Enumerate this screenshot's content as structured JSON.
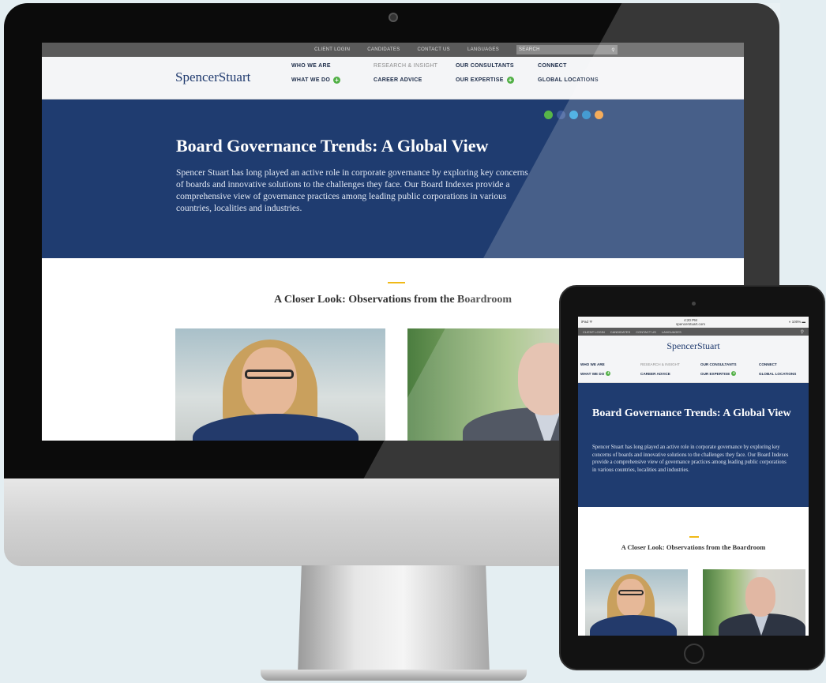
{
  "desktop": {
    "utility": {
      "client_login": "CLIENT LOGIN",
      "candidates": "CANDIDATES",
      "contact_us": "CONTACT US",
      "languages": "LANGUAGES",
      "search_placeholder": "SEARCH"
    },
    "logo": "SpencerStuart",
    "nav": {
      "who_we_are": "WHO WE ARE",
      "research": "RESEARCH & INSIGHT",
      "our_consultants": "OUR CONSULTANTS",
      "connect": "CONNECT",
      "what_we_do": "WHAT WE DO",
      "career_advice": "CAREER ADVICE",
      "our_expertise": "OUR EXPERTISE",
      "global_locations": "GLOBAL LOCATIONS"
    },
    "hero": {
      "title": "Board Governance Trends: A Global View",
      "body": "Spencer Stuart has long played an active role in corporate governance by exploring key concerns of boards and innovative solutions to the challenges they face. Our Board Indexes provide a comprehensive view of governance practices among leading public corporations in various countries, localities and industries."
    },
    "section_title": "A Closer Look: Observations from the Boardroom"
  },
  "tablet": {
    "status": {
      "left": "iPad ᯤ",
      "time": "4:20 PM",
      "url": "spencerstuart.com",
      "right": "⋄ 100% ▬"
    },
    "utility": {
      "client_login": "CLIENT LOGIN",
      "candidates": "CANDIDATES",
      "contact_us": "CONTACT US",
      "languages": "LANGUAGES"
    },
    "logo": "SpencerStuart",
    "nav": {
      "who_we_are": "WHO WE ARE",
      "research": "RESEARCH & INSIGHT",
      "our_consultants": "OUR CONSULTANTS",
      "connect": "CONNECT",
      "what_we_do": "WHAT WE DO",
      "career_advice": "CAREER ADVICE",
      "our_expertise": "OUR EXPERTISE",
      "global_locations": "GLOBAL LOCATIONS"
    },
    "hero": {
      "title": "Board Governance Trends: A Global View",
      "body": "Spencer Stuart has long played an active role in corporate governance by exploring key concerns of boards and innovative solutions to the challenges they face. Our Board Indexes provide a comprehensive view of governance practices among leading public corporations in various countries, localities and industries."
    },
    "section_title": "A Closer Look: Observations from the Boardroom"
  },
  "plus_symbol": "+",
  "search_icon": "⚲",
  "colors": {
    "brand_navy": "#1f3c70",
    "accent_green": "#52b046",
    "accent_gold": "#f0b917",
    "social_green": "#57b648",
    "facebook": "#3b5998",
    "twitter": "#2ea3df",
    "linkedin": "#1d86c7",
    "rss": "#f39a37"
  }
}
